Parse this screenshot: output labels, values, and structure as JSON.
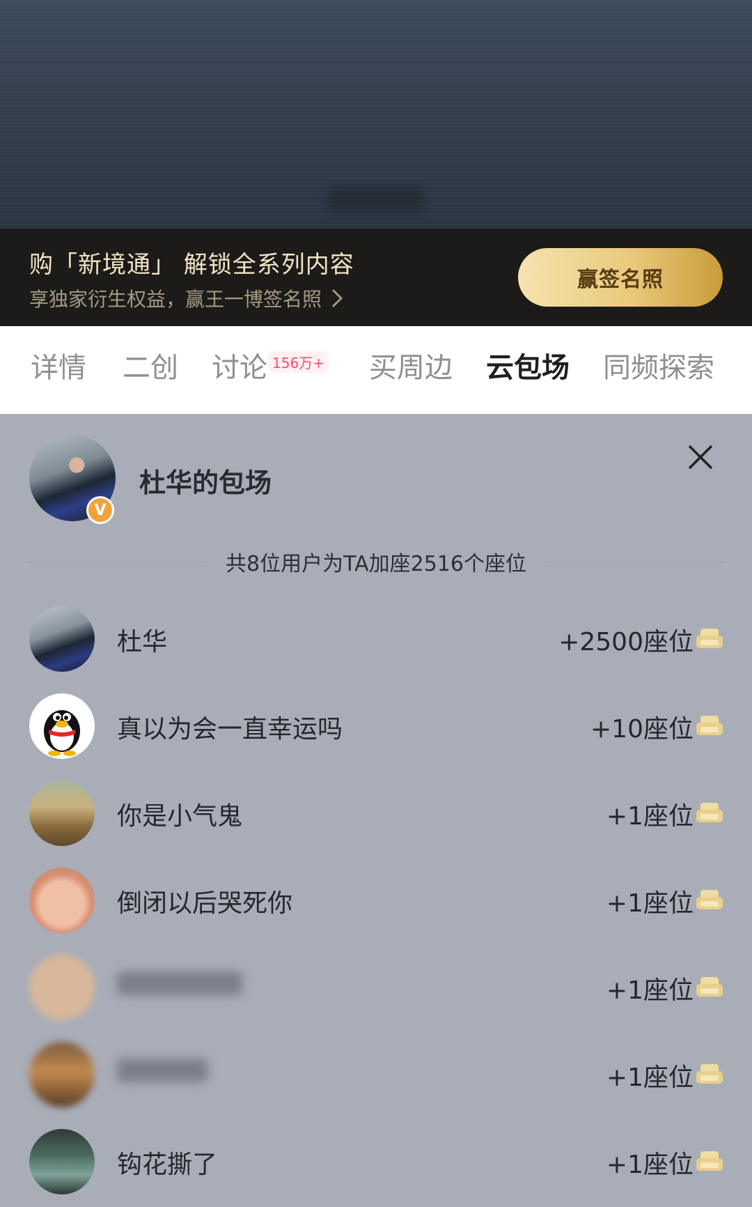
{
  "promo": {
    "title": "购「新境通」 解锁全系列内容",
    "subtitle": "享独家衍生权益，赢王一博签名照",
    "button_label": "赢签名照"
  },
  "tabs": {
    "items": [
      "详情",
      "二创",
      "讨论",
      "买周边",
      "云包场",
      "同频探索"
    ],
    "active": "云包场",
    "discussion_badge": "156万+"
  },
  "panel": {
    "host_name": "杜华的包场",
    "verified_badge": "V",
    "summary": "共8位用户为TA加座2516个座位",
    "seat_icon_color": "#e8d08a",
    "rows": [
      {
        "name": "杜华",
        "seats": "+2500座位"
      },
      {
        "name": "真以为会一直幸运吗",
        "seats": "+10座位"
      },
      {
        "name": "你是小气鬼",
        "seats": "+1座位"
      },
      {
        "name": "倒闭以后哭死你",
        "seats": "+1座位"
      },
      {
        "name": "",
        "seats": "+1座位"
      },
      {
        "name": "",
        "seats": "+1座位"
      },
      {
        "name": "钩花撕了",
        "seats": "+1座位"
      }
    ]
  }
}
